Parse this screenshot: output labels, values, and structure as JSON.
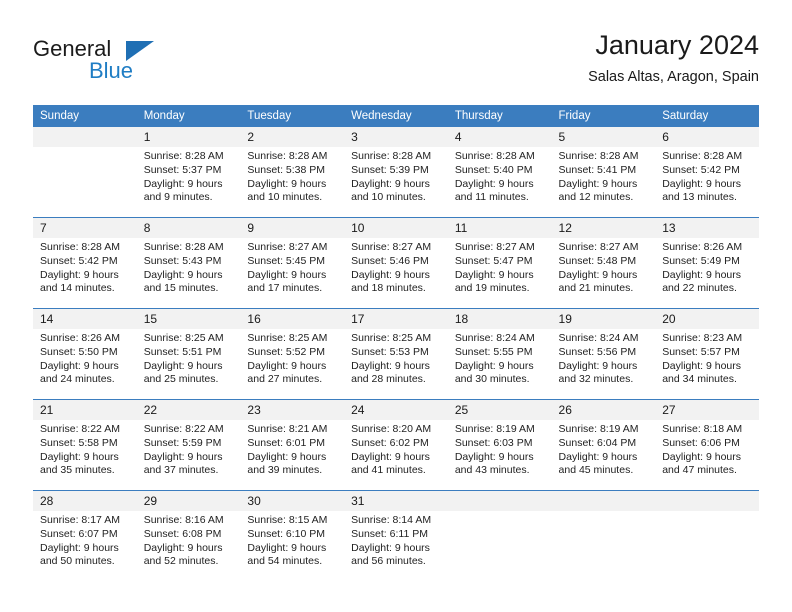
{
  "brand": {
    "name_top": "General",
    "name_bottom": "Blue",
    "triangle_color": "#1f6fb4",
    "accent_color": "#3b7dbf"
  },
  "header": {
    "title": "January 2024",
    "subtitle": "Salas Altas, Aragon, Spain"
  },
  "weekday_headers": [
    "Sunday",
    "Monday",
    "Tuesday",
    "Wednesday",
    "Thursday",
    "Friday",
    "Saturday"
  ],
  "weeks": [
    [
      {
        "day": "",
        "lines": []
      },
      {
        "day": "1",
        "lines": [
          "Sunrise: 8:28 AM",
          "Sunset: 5:37 PM",
          "Daylight: 9 hours",
          "and 9 minutes."
        ]
      },
      {
        "day": "2",
        "lines": [
          "Sunrise: 8:28 AM",
          "Sunset: 5:38 PM",
          "Daylight: 9 hours",
          "and 10 minutes."
        ]
      },
      {
        "day": "3",
        "lines": [
          "Sunrise: 8:28 AM",
          "Sunset: 5:39 PM",
          "Daylight: 9 hours",
          "and 10 minutes."
        ]
      },
      {
        "day": "4",
        "lines": [
          "Sunrise: 8:28 AM",
          "Sunset: 5:40 PM",
          "Daylight: 9 hours",
          "and 11 minutes."
        ]
      },
      {
        "day": "5",
        "lines": [
          "Sunrise: 8:28 AM",
          "Sunset: 5:41 PM",
          "Daylight: 9 hours",
          "and 12 minutes."
        ]
      },
      {
        "day": "6",
        "lines": [
          "Sunrise: 8:28 AM",
          "Sunset: 5:42 PM",
          "Daylight: 9 hours",
          "and 13 minutes."
        ]
      }
    ],
    [
      {
        "day": "7",
        "lines": [
          "Sunrise: 8:28 AM",
          "Sunset: 5:42 PM",
          "Daylight: 9 hours",
          "and 14 minutes."
        ]
      },
      {
        "day": "8",
        "lines": [
          "Sunrise: 8:28 AM",
          "Sunset: 5:43 PM",
          "Daylight: 9 hours",
          "and 15 minutes."
        ]
      },
      {
        "day": "9",
        "lines": [
          "Sunrise: 8:27 AM",
          "Sunset: 5:45 PM",
          "Daylight: 9 hours",
          "and 17 minutes."
        ]
      },
      {
        "day": "10",
        "lines": [
          "Sunrise: 8:27 AM",
          "Sunset: 5:46 PM",
          "Daylight: 9 hours",
          "and 18 minutes."
        ]
      },
      {
        "day": "11",
        "lines": [
          "Sunrise: 8:27 AM",
          "Sunset: 5:47 PM",
          "Daylight: 9 hours",
          "and 19 minutes."
        ]
      },
      {
        "day": "12",
        "lines": [
          "Sunrise: 8:27 AM",
          "Sunset: 5:48 PM",
          "Daylight: 9 hours",
          "and 21 minutes."
        ]
      },
      {
        "day": "13",
        "lines": [
          "Sunrise: 8:26 AM",
          "Sunset: 5:49 PM",
          "Daylight: 9 hours",
          "and 22 minutes."
        ]
      }
    ],
    [
      {
        "day": "14",
        "lines": [
          "Sunrise: 8:26 AM",
          "Sunset: 5:50 PM",
          "Daylight: 9 hours",
          "and 24 minutes."
        ]
      },
      {
        "day": "15",
        "lines": [
          "Sunrise: 8:25 AM",
          "Sunset: 5:51 PM",
          "Daylight: 9 hours",
          "and 25 minutes."
        ]
      },
      {
        "day": "16",
        "lines": [
          "Sunrise: 8:25 AM",
          "Sunset: 5:52 PM",
          "Daylight: 9 hours",
          "and 27 minutes."
        ]
      },
      {
        "day": "17",
        "lines": [
          "Sunrise: 8:25 AM",
          "Sunset: 5:53 PM",
          "Daylight: 9 hours",
          "and 28 minutes."
        ]
      },
      {
        "day": "18",
        "lines": [
          "Sunrise: 8:24 AM",
          "Sunset: 5:55 PM",
          "Daylight: 9 hours",
          "and 30 minutes."
        ]
      },
      {
        "day": "19",
        "lines": [
          "Sunrise: 8:24 AM",
          "Sunset: 5:56 PM",
          "Daylight: 9 hours",
          "and 32 minutes."
        ]
      },
      {
        "day": "20",
        "lines": [
          "Sunrise: 8:23 AM",
          "Sunset: 5:57 PM",
          "Daylight: 9 hours",
          "and 34 minutes."
        ]
      }
    ],
    [
      {
        "day": "21",
        "lines": [
          "Sunrise: 8:22 AM",
          "Sunset: 5:58 PM",
          "Daylight: 9 hours",
          "and 35 minutes."
        ]
      },
      {
        "day": "22",
        "lines": [
          "Sunrise: 8:22 AM",
          "Sunset: 5:59 PM",
          "Daylight: 9 hours",
          "and 37 minutes."
        ]
      },
      {
        "day": "23",
        "lines": [
          "Sunrise: 8:21 AM",
          "Sunset: 6:01 PM",
          "Daylight: 9 hours",
          "and 39 minutes."
        ]
      },
      {
        "day": "24",
        "lines": [
          "Sunrise: 8:20 AM",
          "Sunset: 6:02 PM",
          "Daylight: 9 hours",
          "and 41 minutes."
        ]
      },
      {
        "day": "25",
        "lines": [
          "Sunrise: 8:19 AM",
          "Sunset: 6:03 PM",
          "Daylight: 9 hours",
          "and 43 minutes."
        ]
      },
      {
        "day": "26",
        "lines": [
          "Sunrise: 8:19 AM",
          "Sunset: 6:04 PM",
          "Daylight: 9 hours",
          "and 45 minutes."
        ]
      },
      {
        "day": "27",
        "lines": [
          "Sunrise: 8:18 AM",
          "Sunset: 6:06 PM",
          "Daylight: 9 hours",
          "and 47 minutes."
        ]
      }
    ],
    [
      {
        "day": "28",
        "lines": [
          "Sunrise: 8:17 AM",
          "Sunset: 6:07 PM",
          "Daylight: 9 hours",
          "and 50 minutes."
        ]
      },
      {
        "day": "29",
        "lines": [
          "Sunrise: 8:16 AM",
          "Sunset: 6:08 PM",
          "Daylight: 9 hours",
          "and 52 minutes."
        ]
      },
      {
        "day": "30",
        "lines": [
          "Sunrise: 8:15 AM",
          "Sunset: 6:10 PM",
          "Daylight: 9 hours",
          "and 54 minutes."
        ]
      },
      {
        "day": "31",
        "lines": [
          "Sunrise: 8:14 AM",
          "Sunset: 6:11 PM",
          "Daylight: 9 hours",
          "and 56 minutes."
        ]
      },
      {
        "day": "",
        "lines": []
      },
      {
        "day": "",
        "lines": []
      },
      {
        "day": "",
        "lines": []
      }
    ]
  ]
}
